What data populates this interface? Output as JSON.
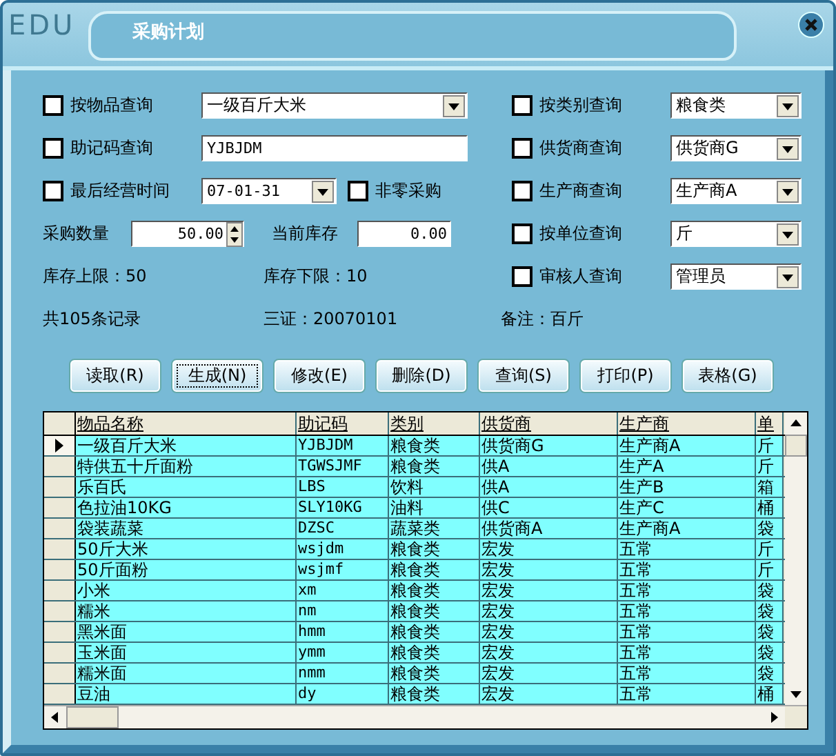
{
  "window": {
    "logo": "EDU",
    "title": "采购计划"
  },
  "form": {
    "item_query": {
      "label": "按物品查询",
      "checked": false,
      "value": "一级百斤大米"
    },
    "code_query": {
      "label": "助记码查询",
      "checked": false,
      "value": "YJBJDM"
    },
    "last_date": {
      "label": "最后经营时间",
      "checked": false,
      "value": "07-01-31"
    },
    "nonzero": {
      "label": "非零采购",
      "checked": false
    },
    "quantity": {
      "label": "采购数量",
      "value": "50.00"
    },
    "stock": {
      "label": "当前库存",
      "value": "0.00"
    },
    "stock_max": "库存上限：50",
    "stock_min": "库存下限：10",
    "record_count": "共105条记录",
    "certificate": "三证：20070101",
    "note": "备注：百斤"
  },
  "right_queries": [
    {
      "label": "按类别查询",
      "checked": false,
      "value": "粮食类"
    },
    {
      "label": "供货商查询",
      "checked": false,
      "value": "供货商G"
    },
    {
      "label": "生产商查询",
      "checked": false,
      "value": "生产商A"
    },
    {
      "label": "按单位查询",
      "checked": false,
      "value": "斤"
    },
    {
      "label": "审核人查询",
      "checked": false,
      "value": "管理员"
    }
  ],
  "buttons": [
    {
      "label": "读取(R)",
      "focused": false
    },
    {
      "label": "生成(N)",
      "focused": true
    },
    {
      "label": "修改(E)",
      "focused": false
    },
    {
      "label": "删除(D)",
      "focused": false
    },
    {
      "label": "查询(S)",
      "focused": false
    },
    {
      "label": "打印(P)",
      "focused": false
    },
    {
      "label": "表格(G)",
      "focused": false
    }
  ],
  "table": {
    "columns": [
      "物品名称",
      "助记码",
      "类别",
      "供货商",
      "生产商",
      "单"
    ],
    "rows": [
      {
        "selected": true,
        "cells": [
          "一级百斤大米",
          "YJBJDM",
          "粮食类",
          "供货商G",
          "生产商A",
          "斤"
        ]
      },
      {
        "selected": false,
        "cells": [
          "特供五十斤面粉",
          "TGWSJMF",
          "粮食类",
          "供A",
          "生产A",
          "斤"
        ]
      },
      {
        "selected": false,
        "cells": [
          "乐百氏",
          "LBS",
          "饮料",
          "供A",
          "生产B",
          "箱"
        ]
      },
      {
        "selected": false,
        "cells": [
          "色拉油10KG",
          "SLY10KG",
          "油料",
          "供C",
          "生产C",
          "桶"
        ]
      },
      {
        "selected": false,
        "cells": [
          "袋装蔬菜",
          "DZSC",
          "蔬菜类",
          "供货商A",
          "生产商A",
          "袋"
        ]
      },
      {
        "selected": false,
        "cells": [
          "50斤大米",
          "wsjdm",
          "粮食类",
          "宏发",
          "五常",
          "斤"
        ]
      },
      {
        "selected": false,
        "cells": [
          "50斤面粉",
          "wsjmf",
          "粮食类",
          "宏发",
          "五常",
          "斤"
        ]
      },
      {
        "selected": false,
        "cells": [
          "小米",
          "xm",
          "粮食类",
          "宏发",
          "五常",
          "袋"
        ]
      },
      {
        "selected": false,
        "cells": [
          "糯米",
          "nm",
          "粮食类",
          "宏发",
          "五常",
          "袋"
        ]
      },
      {
        "selected": false,
        "cells": [
          "黑米面",
          "hmm",
          "粮食类",
          "宏发",
          "五常",
          "袋"
        ]
      },
      {
        "selected": false,
        "cells": [
          "玉米面",
          "ymm",
          "粮食类",
          "宏发",
          "五常",
          "袋"
        ]
      },
      {
        "selected": false,
        "cells": [
          "糯米面",
          "nmm",
          "粮食类",
          "宏发",
          "五常",
          "袋"
        ]
      },
      {
        "selected": false,
        "cells": [
          "豆油",
          "dy",
          "粮食类",
          "宏发",
          "五常",
          "桶"
        ]
      }
    ]
  }
}
